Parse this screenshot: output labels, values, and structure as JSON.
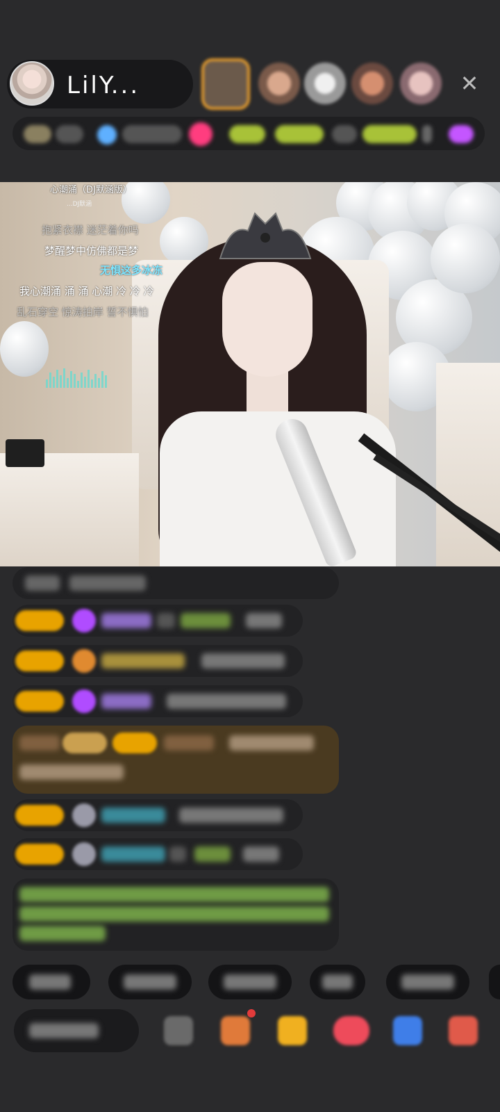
{
  "header": {
    "host_name": "LilY...",
    "close_icon": "close-icon"
  },
  "video": {
    "lyrics": {
      "song_title": "心潮涌（DJ默涵版）",
      "song_subtitle": "...DJ默涵",
      "lines": [
        "抱紧衣襟 迷茫着你吗",
        "梦醒梦中仿佛都是梦",
        "无惧这多冰冻",
        "我心潮涌 涌 涌 心潮 冷 冷 冷",
        "乱石穿空 惊涛拍岸 誓不惧怕"
      ]
    }
  },
  "colors": {
    "background": "#2a2a2c",
    "badge": "#e8a300",
    "highlight_row": "#4a3a20",
    "active_lyric": "#7fe6ff"
  }
}
